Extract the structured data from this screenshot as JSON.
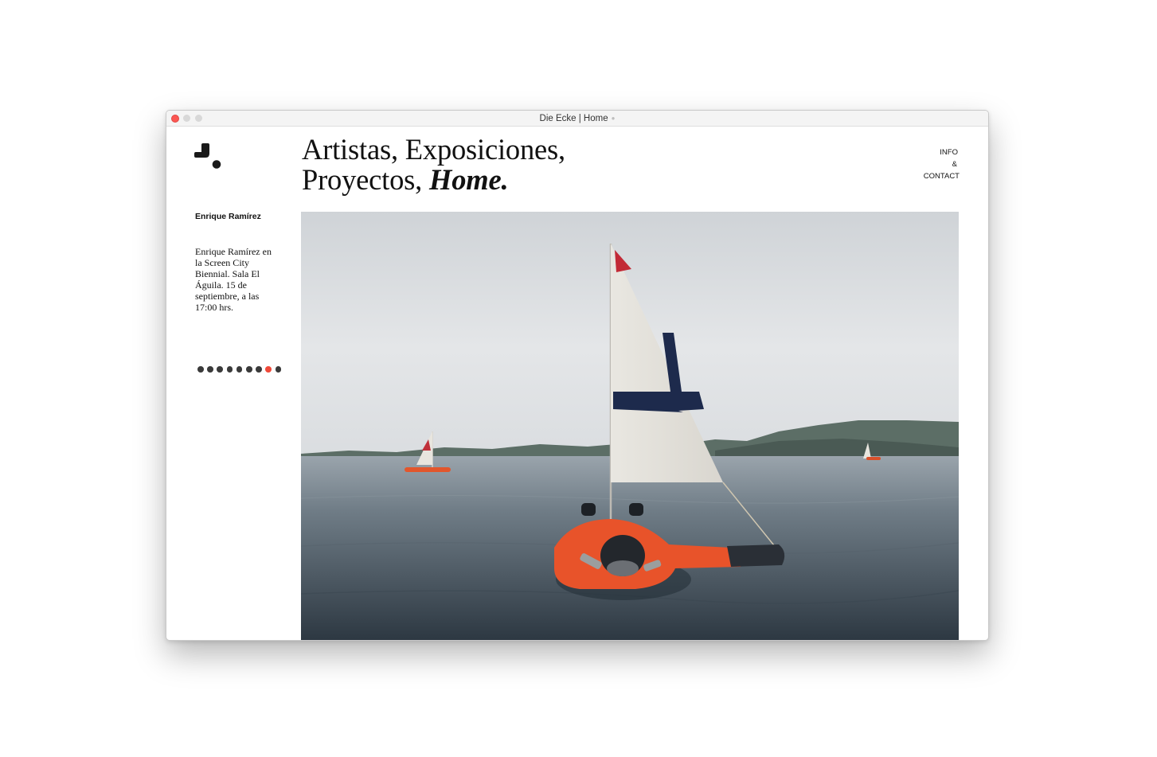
{
  "window": {
    "title": "Die Ecke | Home"
  },
  "site": {
    "logo_icon": "die-ecke-logo-icon",
    "headline_line1": "Artistas, Exposiciones,",
    "headline_line2_plain": "Proyectos, ",
    "headline_line2_emph": "Home."
  },
  "nav": {
    "info": "INFO",
    "amp": "&",
    "contact": "CONTACT"
  },
  "sidebar": {
    "artist_name": "Enrique Ramírez",
    "description": "Enrique Ramírez en\nla Screen City\nBiennial. Sala El\nÁguila. 15 de\nseptiembre, a las\n17:00 hrs."
  },
  "slider": {
    "count": 9,
    "active_index": 7,
    "active_color": "#ef4a3a",
    "inactive_color": "#3a3a3a"
  },
  "colors": {
    "accent": "#ef4a3a",
    "text": "#111111"
  }
}
